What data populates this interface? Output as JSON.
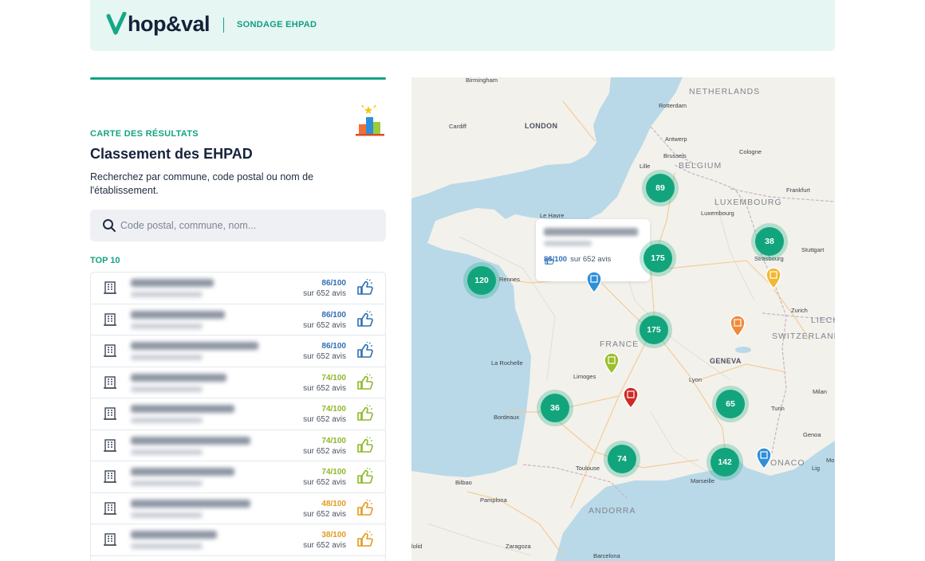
{
  "header": {
    "brand": "hop&val",
    "subtitle": "SONDAGE EHPAD"
  },
  "results": {
    "kicker": "CARTE DES RÉSULTATS",
    "title": "Classement des EHPAD",
    "description": "Recherchez par commune, code postal ou nom de l'établissement.",
    "search_placeholder": "Code postal, commune, nom...",
    "top_label": "TOP 10"
  },
  "colors": {
    "accent": "#13a383",
    "score_blue": "#2f6fb4",
    "score_green": "#8db82a",
    "score_orange": "#e39a1e"
  },
  "list": [
    {
      "score": "86/100",
      "count": "sur 652 avis",
      "tier": "blue"
    },
    {
      "score": "86/100",
      "count": "sur 652 avis",
      "tier": "blue"
    },
    {
      "score": "86/100",
      "count": "sur 652 avis",
      "tier": "blue"
    },
    {
      "score": "74/100",
      "count": "sur 652 avis",
      "tier": "green"
    },
    {
      "score": "74/100",
      "count": "sur 652 avis",
      "tier": "green"
    },
    {
      "score": "74/100",
      "count": "sur 652 avis",
      "tier": "green"
    },
    {
      "score": "74/100",
      "count": "sur 652 avis",
      "tier": "green"
    },
    {
      "score": "48/100",
      "count": "sur 652 avis",
      "tier": "orange"
    },
    {
      "score": "38/100",
      "count": "sur 652 avis",
      "tier": "orange"
    }
  ],
  "map": {
    "popup": {
      "score": "86/100",
      "count": "sur 652 avis"
    },
    "countries": [
      "NETHERLANDS",
      "BELGIUM",
      "LUXEMBOURG",
      "FRANCE",
      "SWITZERLAND",
      "LIECH",
      "ANDORRA",
      "ONACO"
    ],
    "cities": [
      "Birmingham",
      "LONDON",
      "Cardiff",
      "Rotterdam",
      "Antwerp",
      "Brussels",
      "Cologne",
      "Lille",
      "Frankfurt",
      "Luxembourg",
      "Le Havre",
      "Stuttgart",
      "Strasbourg",
      "Rennes",
      "Zurich",
      "La Rochelle",
      "Limoges",
      "Lyon",
      "GENEVA",
      "Milan",
      "Bordeaux",
      "Turin",
      "Genoa",
      "Toulouse",
      "Marseille",
      "Bilbao",
      "Pamplona",
      "Zaragoza",
      "Barcelona",
      "lolid",
      "Lig",
      "Mo"
    ],
    "clusters": [
      "89",
      "175",
      "38",
      "120",
      "175",
      "36",
      "65",
      "74",
      "142"
    ]
  }
}
